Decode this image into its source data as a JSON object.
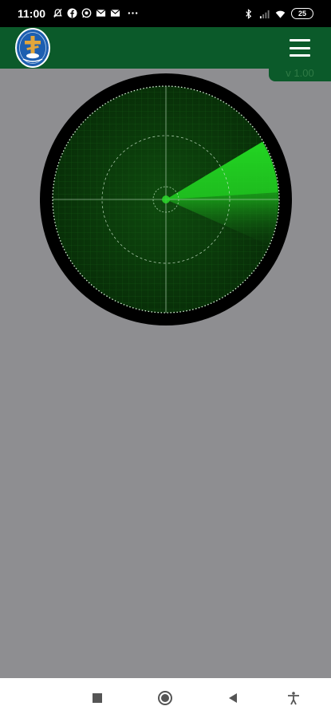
{
  "status_bar": {
    "time": "11:00",
    "battery": "25",
    "left_icons": [
      "mute-icon",
      "facebook-icon",
      "whatsapp-icon",
      "mail-icon",
      "mail-icon",
      "more-icon"
    ],
    "right_icons": [
      "bluetooth-icon",
      "signal-icon",
      "wifi-icon"
    ]
  },
  "app_bar": {
    "menu_icon": "hamburger-menu-icon",
    "version": "v 1.00",
    "brand_color": "#0b5a2a"
  },
  "radar": {
    "color": "#1fcc1f",
    "sweep_direction": "east-northeast"
  },
  "nav_bar": {
    "items": [
      "recents-icon",
      "home-icon",
      "back-icon",
      "accessibility-icon"
    ]
  }
}
